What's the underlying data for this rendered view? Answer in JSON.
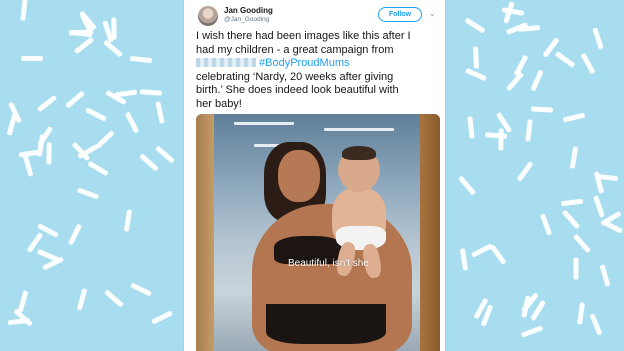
{
  "tweet": {
    "display_name": "Jan Gooding",
    "handle": "@Jan_Gooding",
    "follow_label": "Follow",
    "text_lines": [
      "I wish there had been images like this after I",
      "had my children - a great campaign from",
      "#BodyProudMums",
      "celebrating ‘Nardy, 20 weeks after giving",
      "birth.’ She does indeed look beautiful with",
      "her baby!"
    ],
    "photo_caption": "Beautiful, isn't she"
  },
  "colors": {
    "background": "#a8ddf0",
    "confetti": "#ffffff",
    "link": "#1da1f2",
    "text": "#14171a"
  },
  "icons": {
    "caret": "chevron-down-icon",
    "avatar": "avatar"
  }
}
